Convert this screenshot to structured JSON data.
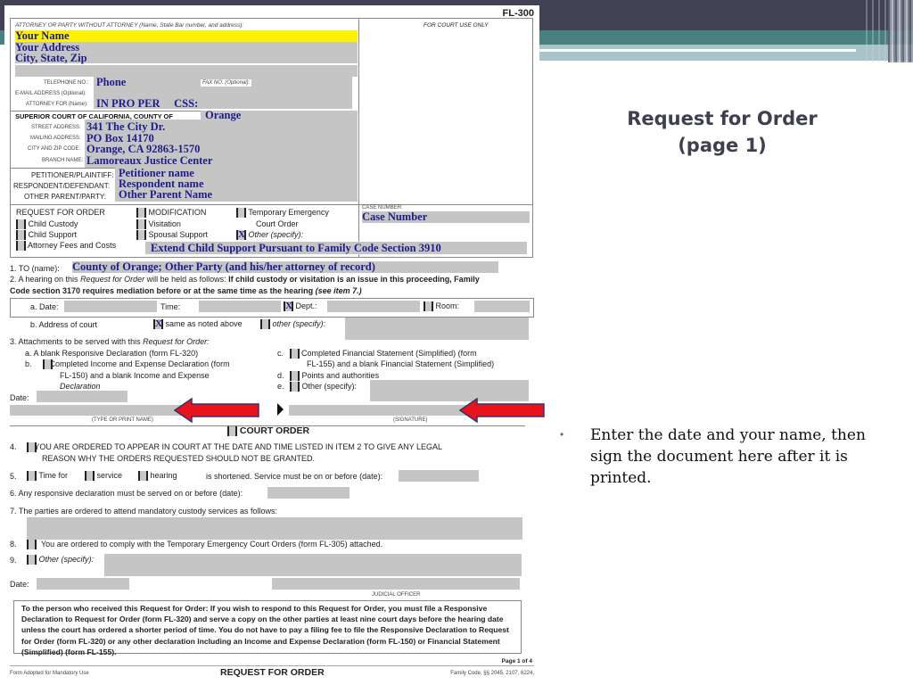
{
  "slide": {
    "title_line1": "Request for Order",
    "title_line2": "(page 1)",
    "bullet": "Enter the date and your name, then sign the document here after it is printed.",
    "colors": {
      "header_dark": "#414355",
      "header_teal": "#47807f",
      "bullet": "#8b4fa0",
      "arrow": "#e8141b"
    }
  },
  "form": {
    "form_number": "FL-300",
    "attorney_header": "ATTORNEY OR PARTY WITHOUT ATTORNEY (Name, State Bar number, and address):",
    "court_use_only": "FOR COURT USE ONLY",
    "your_name": "Your Name",
    "your_address": "Your Address",
    "city_state_zip": "City, State, Zip",
    "telephone_label": "TELEPHONE NO.:",
    "telephone_value": "Phone",
    "fax_label": "FAX NO. (Optional):",
    "email_label": "E-MAIL ADDRESS (Optional):",
    "attorney_for_label": "ATTORNEY FOR (Name):",
    "attorney_for_value": "IN PRO PER     CSS:",
    "court_label": "SUPERIOR COURT OF CALIFORNIA, COUNTY OF",
    "county_value": "Orange",
    "street_label": "STREET ADDRESS:",
    "street_value": "341 The City Dr.",
    "mailing_label": "MAILING ADDRESS:",
    "mailing_value": "PO Box 14170",
    "cityzip_label": "CITY AND ZIP CODE:",
    "cityzip_value": "Orange, CA  92863-1570",
    "branch_label": "BRANCH NAME:",
    "branch_value": "Lamoreaux Justice Center",
    "petitioner_label": "PETITIONER/PLAINTIFF:",
    "petitioner_value": "Petitioner name",
    "respondent_label": "RESPONDENT/DEFENDANT:",
    "respondent_value": "Respondent name",
    "other_parent_label": "OTHER PARENT/PARTY:",
    "other_parent_value": "Other Parent Name",
    "rfo_title": "REQUEST FOR ORDER",
    "case_number_label": "CASE NUMBER:",
    "case_number_value": "Case Number",
    "rfo_options": [
      {
        "label": "Child Custody",
        "mark": ""
      },
      {
        "label": "Child Support",
        "mark": ""
      },
      {
        "label": "Attorney Fees and Costs",
        "mark": ""
      },
      {
        "label": "MODIFICATION",
        "mark": ""
      },
      {
        "label": "Visitation",
        "mark": ""
      },
      {
        "label": "Spousal Support",
        "mark": ""
      },
      {
        "label": "Temporary Emergency",
        "label2": "Court Order",
        "mark": ""
      },
      {
        "label": "Other (specify):",
        "mark": "X"
      }
    ],
    "other_specify_value": "Extend Child Support Pursuant to Family Code Section 3910",
    "item1_label": "1.   TO (name):",
    "item1_value": "County of Orange; Other Party (and his/her attorney of record)",
    "item2_line1_a": "2.   A hearing on this ",
    "item2_line1_b": "Request for Order",
    "item2_line1_c": " will be held as follows: ",
    "item2_line1_d": "If child custody or visitation is an issue in this proceeding, Family",
    "item2_line2_a": "Code section 3170 requires mediation before or at the same time as the hearing ",
    "item2_line2_b": "(see item 7.)",
    "date_label": "a.  Date:",
    "time_label": "Time:",
    "dept_label": "Dept.:",
    "dept_mark": "X",
    "room_label": "Room:",
    "address_label": "b.  Address of court",
    "same_mark": "X",
    "same_label": "same as noted above",
    "other_addr_label": "other (specify):",
    "item3_a": "3.   Attachments to be served with this ",
    "item3_b": "Request for Order:",
    "item3a": "a.   A blank Responsive Declaration (form FL-320)",
    "item3b_1": "b.        Completed Income and Expense Declaration (form",
    "item3b_2": "FL-150) and a blank Income and Expense",
    "item3b_3": "Declaration",
    "item3c_1": "c.        Completed Financial Statement (Simplified) (form",
    "item3c_2": "FL-155) and a blank Financial Statement (Simplified)",
    "item3d": "d.        Points and authorities",
    "item3e": "e.        Other (specify):",
    "date_sig_label": "Date:",
    "type_print_name": "(TYPE OR PRINT NAME)",
    "signature": "(SIGNATURE)",
    "court_order_title": "COURT ORDER",
    "item4_1": "4.        YOU ARE ORDERED TO APPEAR IN COURT AT THE DATE AND TIME LISTED IN ITEM 2 TO GIVE ANY LEGAL",
    "item4_2": "REASON WHY THE ORDERS REQUESTED SHOULD NOT BE GRANTED.",
    "item5_num": "5.",
    "item5_time": "Time for",
    "item5_service": "service",
    "item5_hearing": "hearing",
    "item5_rest": "is shortened. Service must be on or before (date):",
    "item6": "6.   Any responsive declaration must be served on or before (date):",
    "item7": "7.   The parties are ordered to attend mandatory custody services as follows:",
    "item8_num": "8.",
    "item8": "You are ordered to comply with the Temporary Emergency Court Orders (form FL-305) attached.",
    "item9_num": "9.",
    "item9": "Other (specify):",
    "judge_date_label": "Date:",
    "judicial_officer": "JUDICIAL OFFICER",
    "notice_text": "To the person who received this Request for Order: If you wish to respond to this Request for Order, you must file a Responsive Declaration to Request for Order (form FL-320) and serve a copy on the other parties at least nine court days before the hearing date unless the court has ordered a shorter period of time. You do not have to pay a filing fee to file the Responsive Declaration to Request for Order (form FL-320) or any other declaration including an Income and Expense Declaration (form FL-150) or Financial Statement (Simplified) (form FL-155).",
    "page_of": "Page 1 of 4",
    "footer_left": "Form Adopted for Mandatory Use",
    "footer_title": "REQUEST FOR ORDER",
    "footer_right": "Family Code, §§ 2045, 2107, 6224,"
  }
}
